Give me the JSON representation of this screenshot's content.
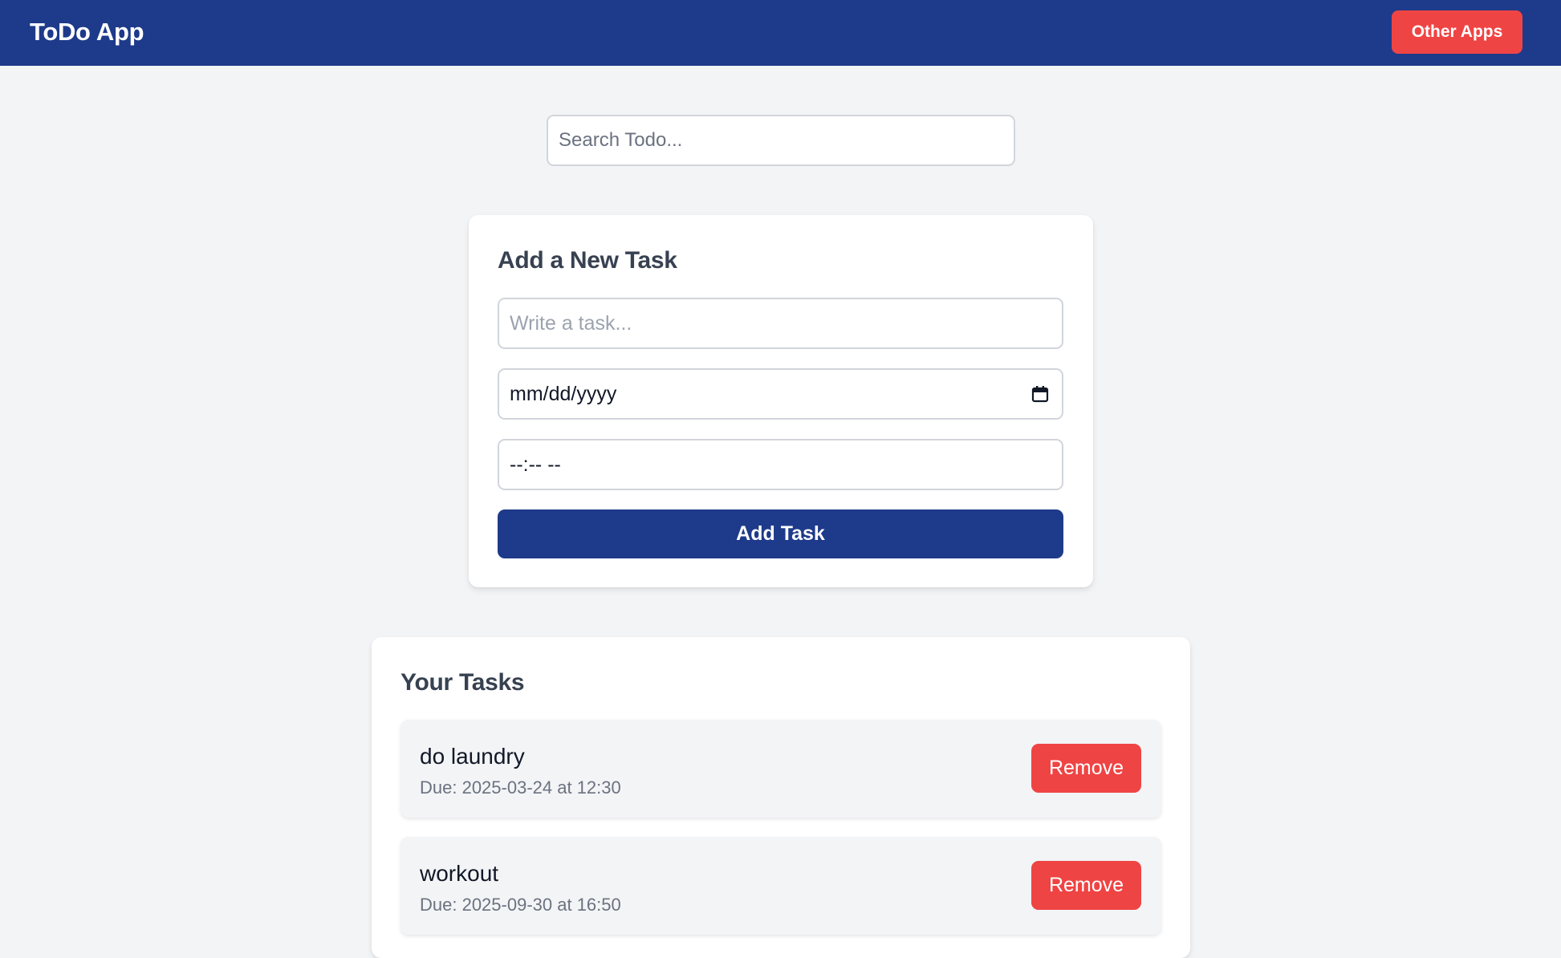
{
  "header": {
    "title": "ToDo App",
    "other_apps_label": "Other Apps"
  },
  "search": {
    "placeholder": "Search Todo..."
  },
  "add_task": {
    "heading": "Add a New Task",
    "task_placeholder": "Write a task...",
    "date_placeholder": "mm/dd/yyyy",
    "time_placeholder": "--:-- --",
    "submit_label": "Add Task"
  },
  "tasks": {
    "heading": "Your Tasks",
    "remove_label": "Remove",
    "items": [
      {
        "name": "do laundry",
        "due": "Due: 2025-03-24 at 12:30"
      },
      {
        "name": "workout",
        "due": "Due: 2025-09-30 at 16:50"
      }
    ]
  },
  "colors": {
    "navbar": "#1e3a8a",
    "primary_button": "#1e3a8a",
    "danger_button": "#ef4444",
    "background": "#f3f4f6"
  },
  "icons": {
    "date_field": "calendar-icon"
  }
}
